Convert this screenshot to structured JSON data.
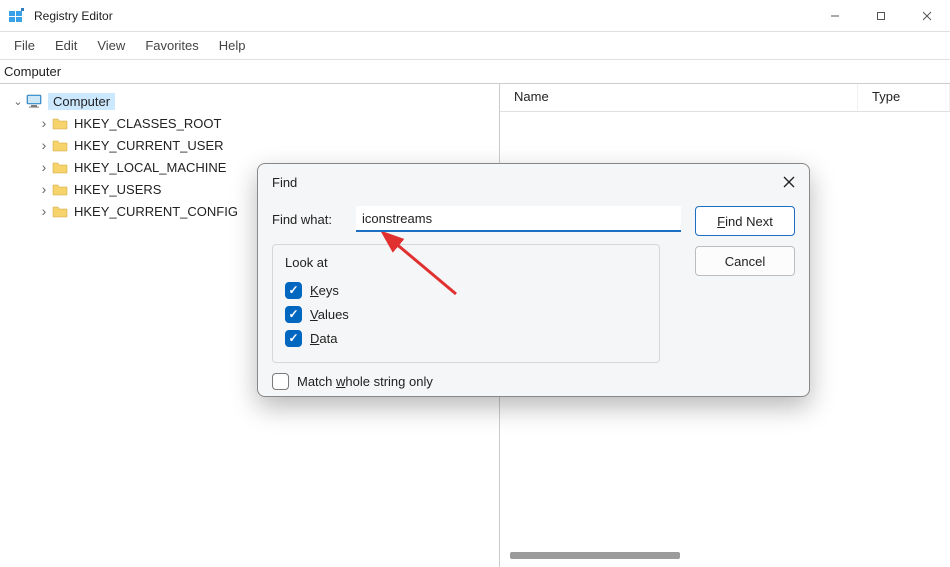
{
  "window": {
    "title": "Registry Editor",
    "controls": {
      "minimize": "minimize",
      "maximize": "maximize",
      "close": "close"
    }
  },
  "menu": [
    "File",
    "Edit",
    "View",
    "Favorites",
    "Help"
  ],
  "address": "Computer",
  "tree": {
    "root": "Computer",
    "children": [
      "HKEY_CLASSES_ROOT",
      "HKEY_CURRENT_USER",
      "HKEY_LOCAL_MACHINE",
      "HKEY_USERS",
      "HKEY_CURRENT_CONFIG"
    ]
  },
  "list": {
    "columns": {
      "name": "Name",
      "type": "Type"
    }
  },
  "dialog": {
    "title": "Find",
    "find_what_label": "Find what:",
    "find_what_value": "iconstreams",
    "look_at_label": "Look at",
    "checks": {
      "keys": {
        "label": "Keys",
        "underline": "K",
        "checked": true
      },
      "values": {
        "label": "Values",
        "underline": "V",
        "checked": true
      },
      "data": {
        "label": "Data",
        "underline": "D",
        "checked": true
      }
    },
    "match_whole": {
      "checked": false,
      "pre": "Match ",
      "underline": "w",
      "post": "hole string only"
    },
    "find_next": {
      "underline": "F",
      "post": "ind Next"
    },
    "cancel": "Cancel"
  }
}
